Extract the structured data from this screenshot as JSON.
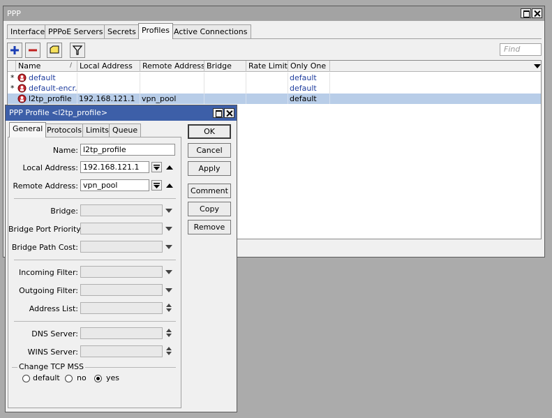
{
  "ppp_window": {
    "title": "PPP",
    "tabs": [
      "Interface",
      "PPPoE Servers",
      "Secrets",
      "Profiles",
      "Active Connections"
    ],
    "active_tab": "Profiles",
    "find_placeholder": "Find",
    "columns": [
      "Name",
      "Local Address",
      "Remote Address",
      "Bridge",
      "Rate Limit...",
      "Only One"
    ],
    "rows": [
      {
        "flag": "*",
        "name": "default",
        "local_address": "",
        "remote_address": "",
        "bridge": "",
        "rate_limit": "",
        "only_one": "default"
      },
      {
        "flag": "*",
        "name": "default-encr...",
        "local_address": "",
        "remote_address": "",
        "bridge": "",
        "rate_limit": "",
        "only_one": "default"
      },
      {
        "flag": "",
        "name": "l2tp_profile",
        "local_address": "192.168.121.1",
        "remote_address": "vpn_pool",
        "bridge": "",
        "rate_limit": "",
        "only_one": "default"
      }
    ],
    "selected_row": "l2tp_profile"
  },
  "dialog": {
    "title": "PPP Profile <l2tp_profile>",
    "tabs": [
      "General",
      "Protocols",
      "Limits",
      "Queue"
    ],
    "active_tab": "General",
    "fields": {
      "name": {
        "label": "Name:",
        "value": "l2tp_profile"
      },
      "local_address": {
        "label": "Local Address:",
        "value": "192.168.121.1"
      },
      "remote_address": {
        "label": "Remote Address:",
        "value": "vpn_pool"
      },
      "bridge": {
        "label": "Bridge:",
        "value": ""
      },
      "bridge_port_priority": {
        "label": "Bridge Port Priority:",
        "value": ""
      },
      "bridge_path_cost": {
        "label": "Bridge Path Cost:",
        "value": ""
      },
      "incoming_filter": {
        "label": "Incoming Filter:",
        "value": ""
      },
      "outgoing_filter": {
        "label": "Outgoing Filter:",
        "value": ""
      },
      "address_list": {
        "label": "Address List:",
        "value": ""
      },
      "dns_server": {
        "label": "DNS Server:",
        "value": ""
      },
      "wins_server": {
        "label": "WINS Server:",
        "value": ""
      }
    },
    "change_tcp_mss": {
      "label": "Change TCP MSS",
      "options": [
        "default",
        "no",
        "yes"
      ],
      "selected": "yes"
    },
    "buttons": {
      "ok": "OK",
      "cancel": "Cancel",
      "apply": "Apply",
      "comment": "Comment",
      "copy": "Copy",
      "remove": "Remove"
    }
  },
  "colors": {
    "dialog_title_bg": "#3d5fa8",
    "selected_row_bg": "#b8cde8",
    "link_text": "#1f3d9e"
  }
}
